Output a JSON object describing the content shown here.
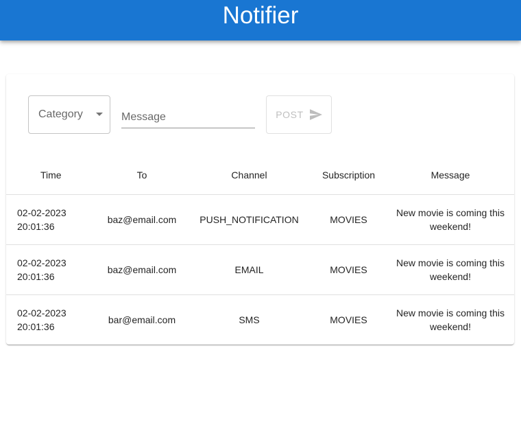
{
  "app": {
    "title": "Notifier"
  },
  "form": {
    "category_label": "Category",
    "message_placeholder": "Message",
    "message_value": "",
    "post_label": "POST"
  },
  "table": {
    "headers": [
      "Time",
      "To",
      "Channel",
      "Subscription",
      "Message"
    ],
    "rows": [
      {
        "time": "02-02-2023 20:01:36",
        "to": "baz@email.com",
        "channel": "PUSH_NOTIFICATION",
        "subscription": "MOVIES",
        "message": "New movie is coming this weekend!"
      },
      {
        "time": "02-02-2023 20:01:36",
        "to": "baz@email.com",
        "channel": "EMAIL",
        "subscription": "MOVIES",
        "message": "New movie is coming this weekend!"
      },
      {
        "time": "02-02-2023 20:01:36",
        "to": "bar@email.com",
        "channel": "SMS",
        "subscription": "MOVIES",
        "message": "New movie is coming this weekend!"
      }
    ]
  },
  "colors": {
    "appbar": "#1976d2",
    "appbar_text": "#ffffff",
    "disabled": "#bdbdbd"
  },
  "icons": {
    "category_dropdown": "chevron-down-icon",
    "post": "send-icon"
  }
}
